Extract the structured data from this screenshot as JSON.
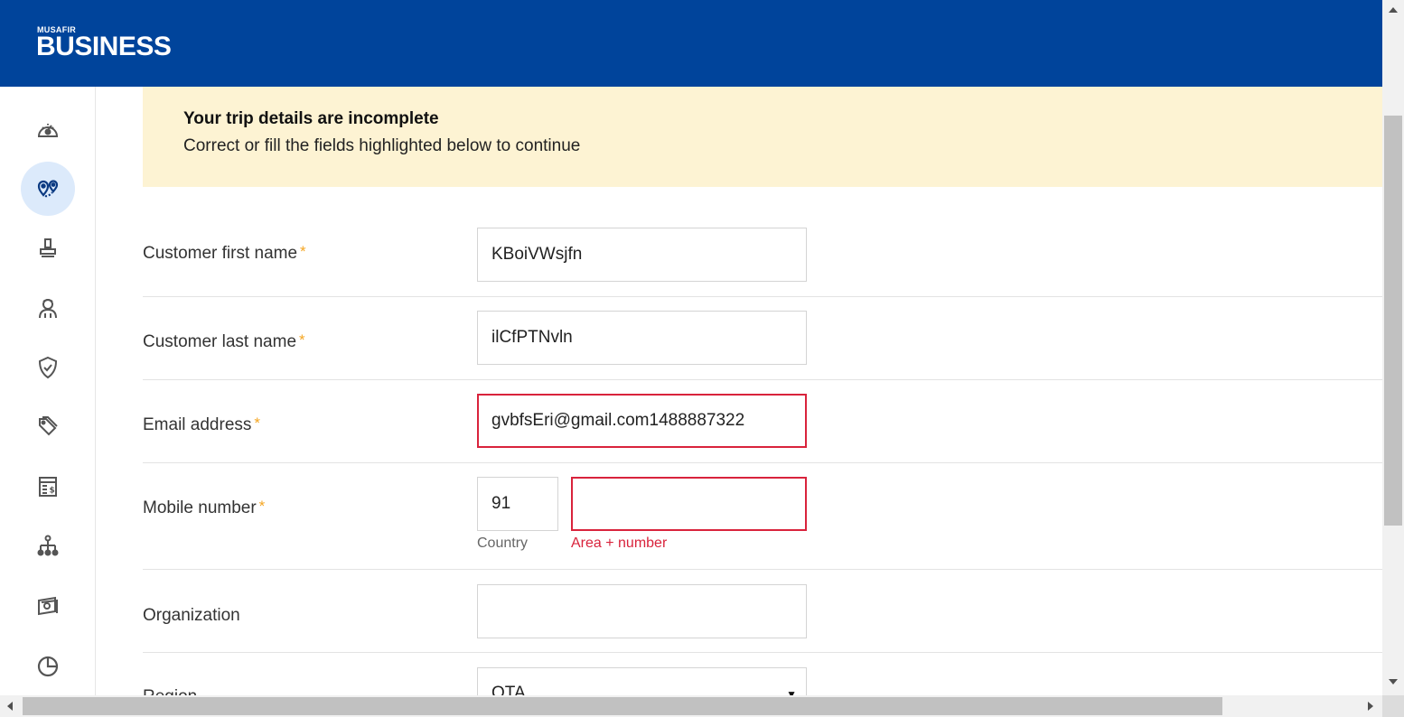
{
  "brand": {
    "small": "MUSAFIR",
    "big": "BUSINESS"
  },
  "sidebar": {
    "items": [
      {
        "icon": "dashboard-icon",
        "active": false
      },
      {
        "icon": "trips-icon",
        "active": true
      },
      {
        "icon": "stamp-icon",
        "active": false
      },
      {
        "icon": "traveler-icon",
        "active": false
      },
      {
        "icon": "shield-check-icon",
        "active": false
      },
      {
        "icon": "tags-icon",
        "active": false
      },
      {
        "icon": "invoice-icon",
        "active": false
      },
      {
        "icon": "hierarchy-icon",
        "active": false
      },
      {
        "icon": "payments-icon",
        "active": false
      },
      {
        "icon": "reports-pie-icon",
        "active": false
      }
    ]
  },
  "alert": {
    "title": "Your trip details are incomplete",
    "message": "Correct or fill the fields highlighted below to continue"
  },
  "form": {
    "first_name": {
      "label": "Customer first name",
      "value": "KBoiVWsjfn",
      "required": "*"
    },
    "last_name": {
      "label": "Customer last name",
      "value": "ilCfPTNvln",
      "required": "*"
    },
    "email": {
      "label": "Email address",
      "value": "gvbfsEri@gmail.com1488887322",
      "required": "*"
    },
    "mobile": {
      "label": "Mobile number",
      "required": "*",
      "country_value": "91",
      "country_caption": "Country",
      "number_value": "",
      "number_caption": "Area + number"
    },
    "organization": {
      "label": "Organization",
      "value": ""
    },
    "region": {
      "label": "Region",
      "value": "OTA"
    }
  },
  "colors": {
    "header": "#00449b",
    "alert_bg": "#fdf3d3",
    "error": "#d9233c",
    "required": "#f5a623",
    "active_nav_bg": "#dceafb"
  }
}
